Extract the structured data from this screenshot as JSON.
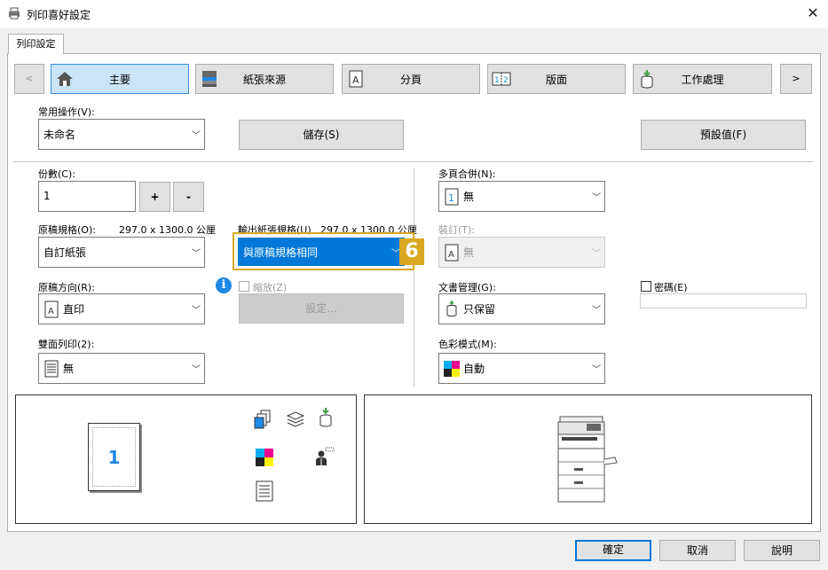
{
  "window": {
    "title": "列印喜好設定",
    "close_glyph": "✕"
  },
  "tabs": [
    {
      "label": "列印設定"
    }
  ],
  "nav": {
    "prev": "<",
    "next": ">",
    "items": [
      {
        "label": "主要",
        "icon": "home-icon"
      },
      {
        "label": "紙張來源",
        "icon": "printer-tray-icon"
      },
      {
        "label": "分頁",
        "icon": "page-a-icon"
      },
      {
        "label": "版面",
        "icon": "layout-icon"
      },
      {
        "label": "工作處理",
        "icon": "job-stack-icon"
      }
    ]
  },
  "favorites": {
    "label": "常用操作(V):",
    "value": "未命名",
    "save": "儲存(S)",
    "defaults": "預設值(F)"
  },
  "copies": {
    "label": "份數(C):",
    "value": "1",
    "plus": "+",
    "minus": "-"
  },
  "original_size": {
    "label": "原稿規格(O):",
    "dims": "297.0 x 1300.0 公厘",
    "value": "自訂紙張"
  },
  "output_size": {
    "label": "輸出紙張規格(U)",
    "dims": "297.0 x 1300.0 公厘",
    "value": "與原稿規格相同",
    "callout": "6"
  },
  "zoom": {
    "label": "縮放(Z)",
    "settings": "設定..."
  },
  "orientation": {
    "label": "原稿方向(R):",
    "value": "直印",
    "icon_letter": "A"
  },
  "duplex": {
    "label": "雙面列印(2):",
    "value": "無"
  },
  "nup": {
    "label": "多頁合併(N):",
    "value": "無",
    "icon_digit": "1"
  },
  "binding": {
    "label": "裝訂(T):",
    "value": "無",
    "icon_letter": "A"
  },
  "retention": {
    "label": "文書管理(G):",
    "value": "只保留"
  },
  "password": {
    "label": "密碼(E)"
  },
  "color_mode": {
    "label": "色彩模式(M):",
    "value": "自動"
  },
  "preview": {
    "page_number": "1"
  },
  "footer": {
    "ok": "確定",
    "cancel": "取消",
    "help": "說明"
  },
  "colors": {
    "accent": "#0078d7",
    "callout": "#d9a722",
    "active_tab": "#cce4f7"
  }
}
